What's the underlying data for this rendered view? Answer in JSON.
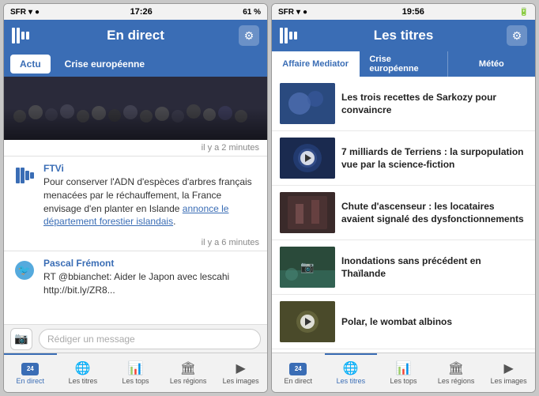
{
  "left_phone": {
    "status_bar": {
      "carrier": "SFR",
      "time": "17:26",
      "battery": "61 %"
    },
    "header": {
      "title": "En direct",
      "gear_label": "⚙"
    },
    "tabs": [
      {
        "id": "actu",
        "label": "Actu",
        "active": true
      },
      {
        "id": "crise",
        "label": "Crise européenne",
        "active": false
      }
    ],
    "timestamp1": "il y a 2 minutes",
    "news_item": {
      "source": "FTVi",
      "text": "Pour conserver l'ADN d'espèces d'arbres français menacées par le réchauffement, la France envisage d'en planter en Islande ",
      "link_text": "annonce le département forestier islandais",
      "link": "#"
    },
    "timestamp2": "il y a 6 minutes",
    "tweet": {
      "author": "Pascal Frémont",
      "text": "RT @bbianchet: Aider le Japon avec lescahi http://bit.ly/ZR8..."
    },
    "input_placeholder": "Rédiger un message"
  },
  "right_phone": {
    "status_bar": {
      "carrier": "SFR",
      "time": "19:56",
      "battery": "■■■"
    },
    "header": {
      "title": "Les titres",
      "gear_label": "⚙"
    },
    "tabs": [
      {
        "id": "mediator",
        "label": "Affaire Mediator",
        "active": true
      },
      {
        "id": "crise",
        "label": "Crise européenne",
        "active": false
      },
      {
        "id": "meteo",
        "label": "Météo",
        "active": false
      }
    ],
    "news_items": [
      {
        "id": 1,
        "thumb_class": "thumb-1",
        "has_play": false,
        "has_camera": false,
        "headline": "Les trois recettes de Sarkozy pour convaincre"
      },
      {
        "id": 2,
        "thumb_class": "thumb-2",
        "has_play": true,
        "has_camera": false,
        "headline": "7 milliards de Terriens : la surpopulation vue par la science-fiction"
      },
      {
        "id": 3,
        "thumb_class": "thumb-3",
        "has_play": false,
        "has_camera": false,
        "headline": "Chute d'ascenseur : les locataires avaient signalé des dysfonctionnements"
      },
      {
        "id": 4,
        "thumb_class": "thumb-4",
        "has_play": false,
        "has_camera": true,
        "headline": "Inondations sans précédent en Thaïlande"
      },
      {
        "id": 5,
        "thumb_class": "thumb-5",
        "has_play": true,
        "has_camera": false,
        "headline": "Polar, le wombat albinos"
      }
    ]
  },
  "bottom_nav": {
    "items": [
      {
        "id": "en-direct",
        "label": "En direct",
        "icon": "24h"
      },
      {
        "id": "les-titres",
        "label": "Les titres",
        "icon": "🌐"
      },
      {
        "id": "les-tops",
        "label": "Les tops",
        "icon": "📊"
      },
      {
        "id": "les-regions",
        "label": "Les régions",
        "icon": "🏛"
      },
      {
        "id": "les-images",
        "label": "Les images",
        "icon": "▶"
      }
    ]
  }
}
